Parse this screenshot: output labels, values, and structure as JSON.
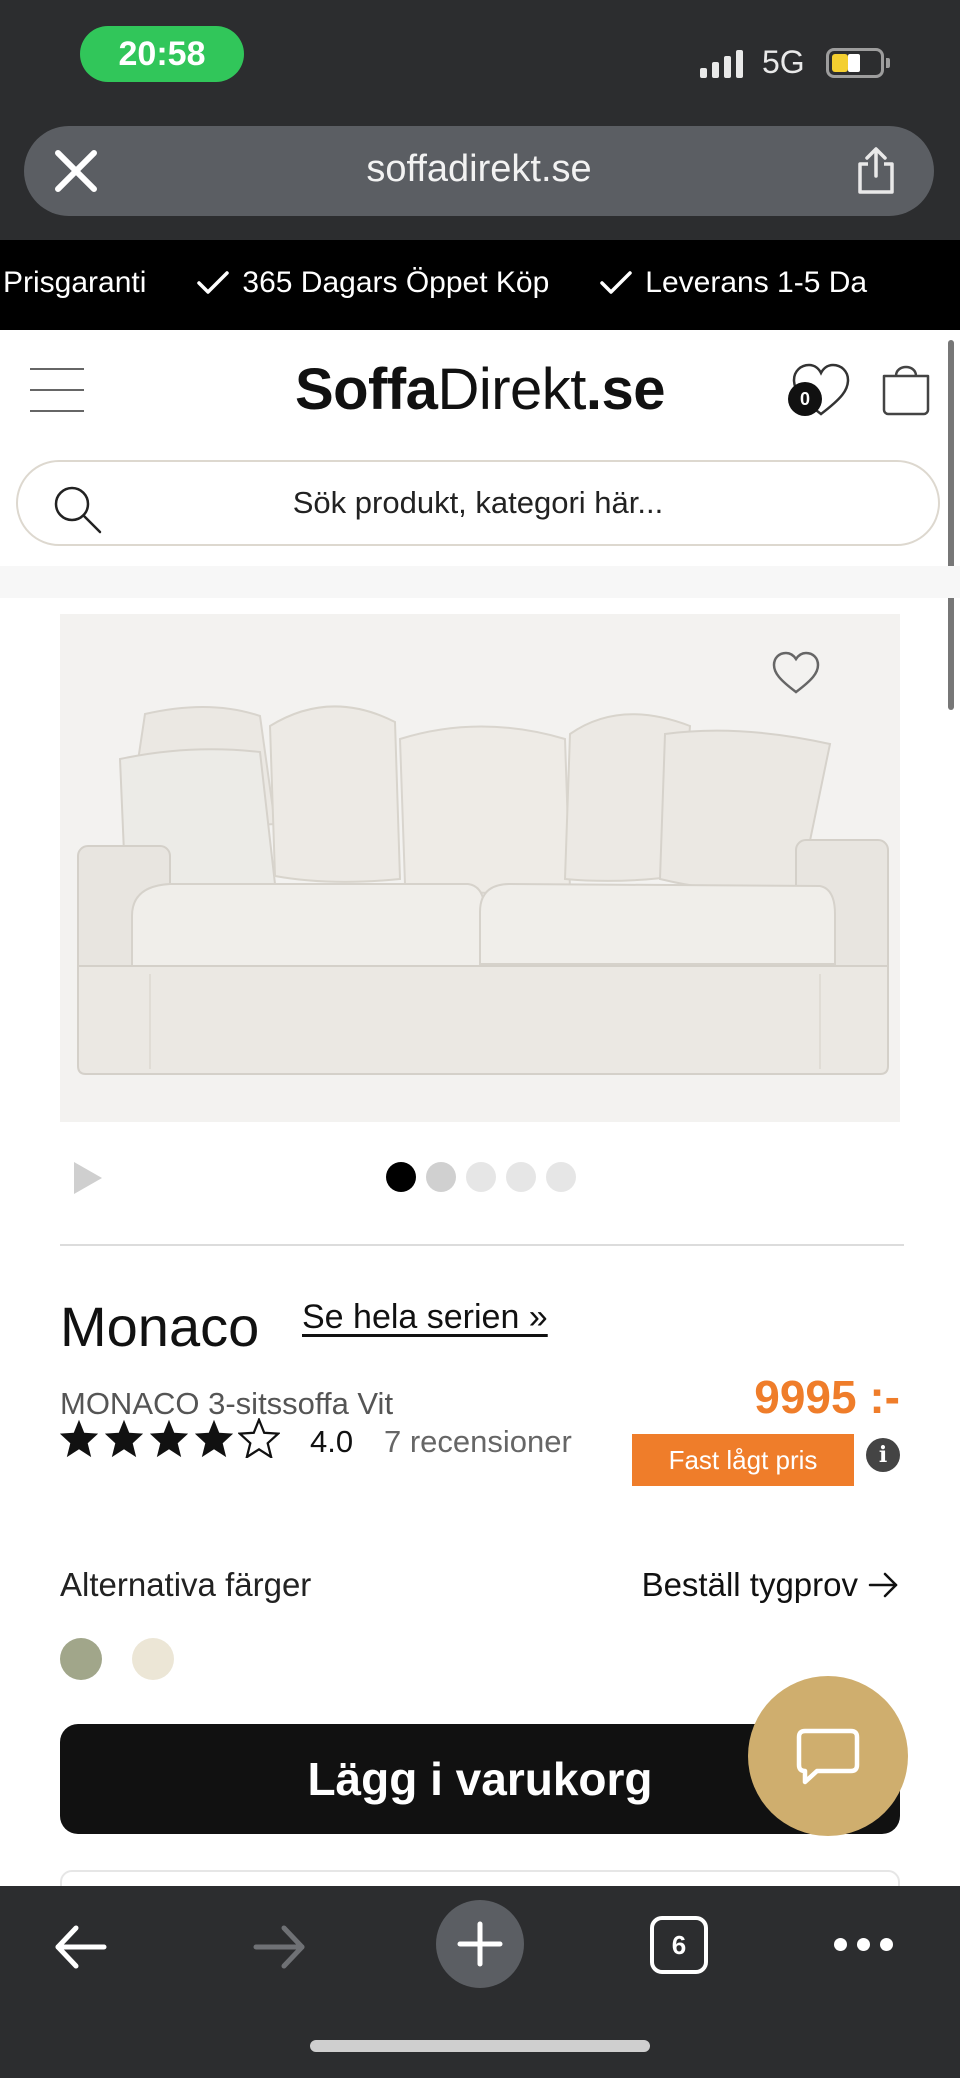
{
  "status_bar": {
    "time": "20:58",
    "network": "5G"
  },
  "browser": {
    "url": "soffadirekt.se",
    "tab_count": "6"
  },
  "promo": {
    "items": [
      "Prisgaranti",
      "365 Dagars Öppet Köp",
      "Leverans 1-5 Da"
    ]
  },
  "header": {
    "logo_bold": "Soffa",
    "logo_regular": "Direkt",
    "logo_suffix": ".se",
    "wishlist_count": "0"
  },
  "search": {
    "placeholder": "Sök produkt, kategori här..."
  },
  "gallery": {
    "image_count": 5,
    "active_index": 0
  },
  "product": {
    "name": "Monaco",
    "series_link": "Se hela serien »",
    "subtitle": "MONACO 3-sitssoffa Vit",
    "rating": "4.0",
    "rating_value": 4,
    "rating_max": 5,
    "reviews": "7 recensioner",
    "price": "9995 :-",
    "badge": "Fast lågt pris",
    "info_symbol": "i"
  },
  "colors": {
    "label": "Alternativa färger",
    "order_sample": "Beställ tygprov",
    "swatches": [
      "#a1a68a",
      "#ece6d6"
    ]
  },
  "cta": {
    "add_to_cart": "Lägg i varukorg"
  },
  "theme": {
    "accent": "#ef7d2a",
    "chat_button": "#cfae6e",
    "status_green": "#31c65a"
  }
}
